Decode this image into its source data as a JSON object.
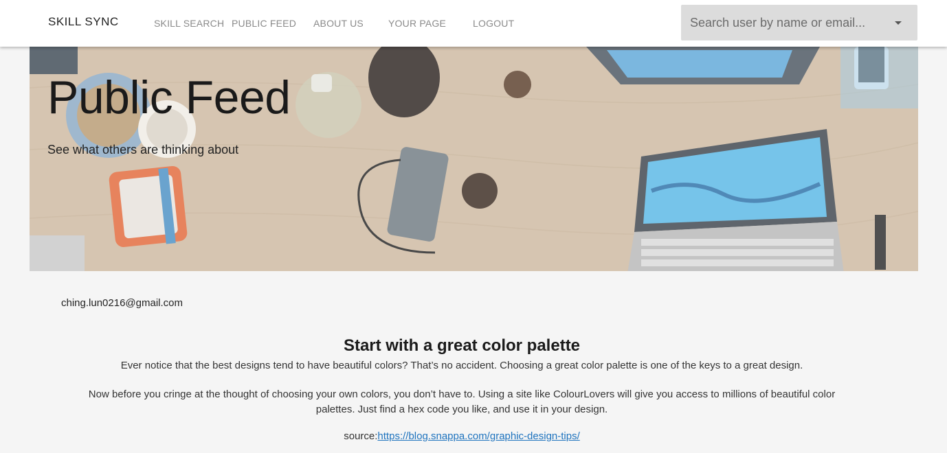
{
  "navbar": {
    "brand": "SKILL SYNC",
    "links": [
      "SKILL SEARCH",
      "PUBLIC FEED",
      "ABOUT US",
      "YOUR PAGE",
      "LOGOUT"
    ],
    "search_placeholder": "Search user by name or email..."
  },
  "hero": {
    "title": "Public Feed",
    "subtitle": "See what others are thinking about"
  },
  "post": {
    "author_email": "ching.lun0216@gmail.com",
    "title": "Start with a great color palette",
    "paragraph1": "Ever notice that the best designs tend to have beautiful colors? That’s no accident. Choosing a great color palette is one of the keys to a great design.",
    "paragraph2": "Now before you cringe at the thought of choosing your own colors, you don’t have to. Using a site like ColourLovers will give you access to millions of beautiful color palettes. Just find a hex code you like, and use it in your design.",
    "source_label": "source:",
    "source_link": "https://blog.snappa.com/graphic-design-tips/"
  },
  "colors": {
    "page_bg": "#f5f5f5",
    "nav_link": "#8a8a8a",
    "link": "#1e73be",
    "search_bg": "#dcdcdc"
  }
}
